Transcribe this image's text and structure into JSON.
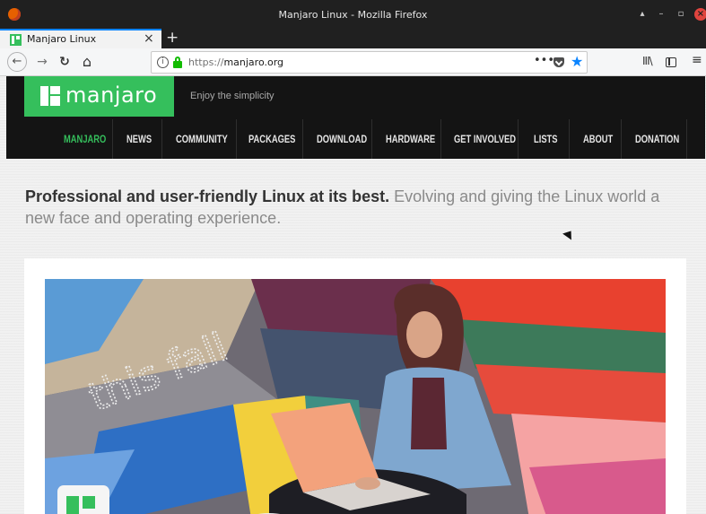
{
  "window": {
    "title": "Manjaro Linux - Mozilla Firefox",
    "controls": {
      "minimize": "–",
      "maximize": "▴",
      "restore": "▫",
      "close": "×"
    }
  },
  "browser": {
    "tab": {
      "label": "Manjaro Linux",
      "close": "×"
    },
    "new_tab": "+",
    "toolbar": {
      "back": "←",
      "forward": "→",
      "reload": "↻",
      "home": "⌂"
    },
    "url": {
      "scheme": "https://",
      "host": "manjaro.org"
    },
    "page_actions": {
      "more": "•••",
      "bookmark": "★"
    },
    "right_icons": {
      "library": "III\\",
      "menu": "≡"
    }
  },
  "site": {
    "logo_text": "manjaro",
    "tagline": "Enjoy the simplicity",
    "nav": [
      {
        "label": "MANJARO",
        "active": true
      },
      {
        "label": "NEWS",
        "active": false
      },
      {
        "label": "COMMUNITY",
        "active": false
      },
      {
        "label": "PACKAGES",
        "active": false
      },
      {
        "label": "DOWNLOAD",
        "active": false
      },
      {
        "label": "HARDWARE",
        "active": false
      },
      {
        "label": "GET INVOLVED",
        "active": false
      },
      {
        "label": "LISTS",
        "active": false
      },
      {
        "label": "ABOUT",
        "active": false
      },
      {
        "label": "DONATION",
        "active": false
      }
    ],
    "lead_bold": "Professional and user-friendly Linux at its best.",
    "lead_rest": " Evolving and giving the Linux world a new face and operating experience.",
    "hero_graffiti": "this fall"
  },
  "colors": {
    "manjaro_green": "#35bf5c",
    "header_black": "#141414",
    "firefox_blue": "#0a84ff"
  }
}
